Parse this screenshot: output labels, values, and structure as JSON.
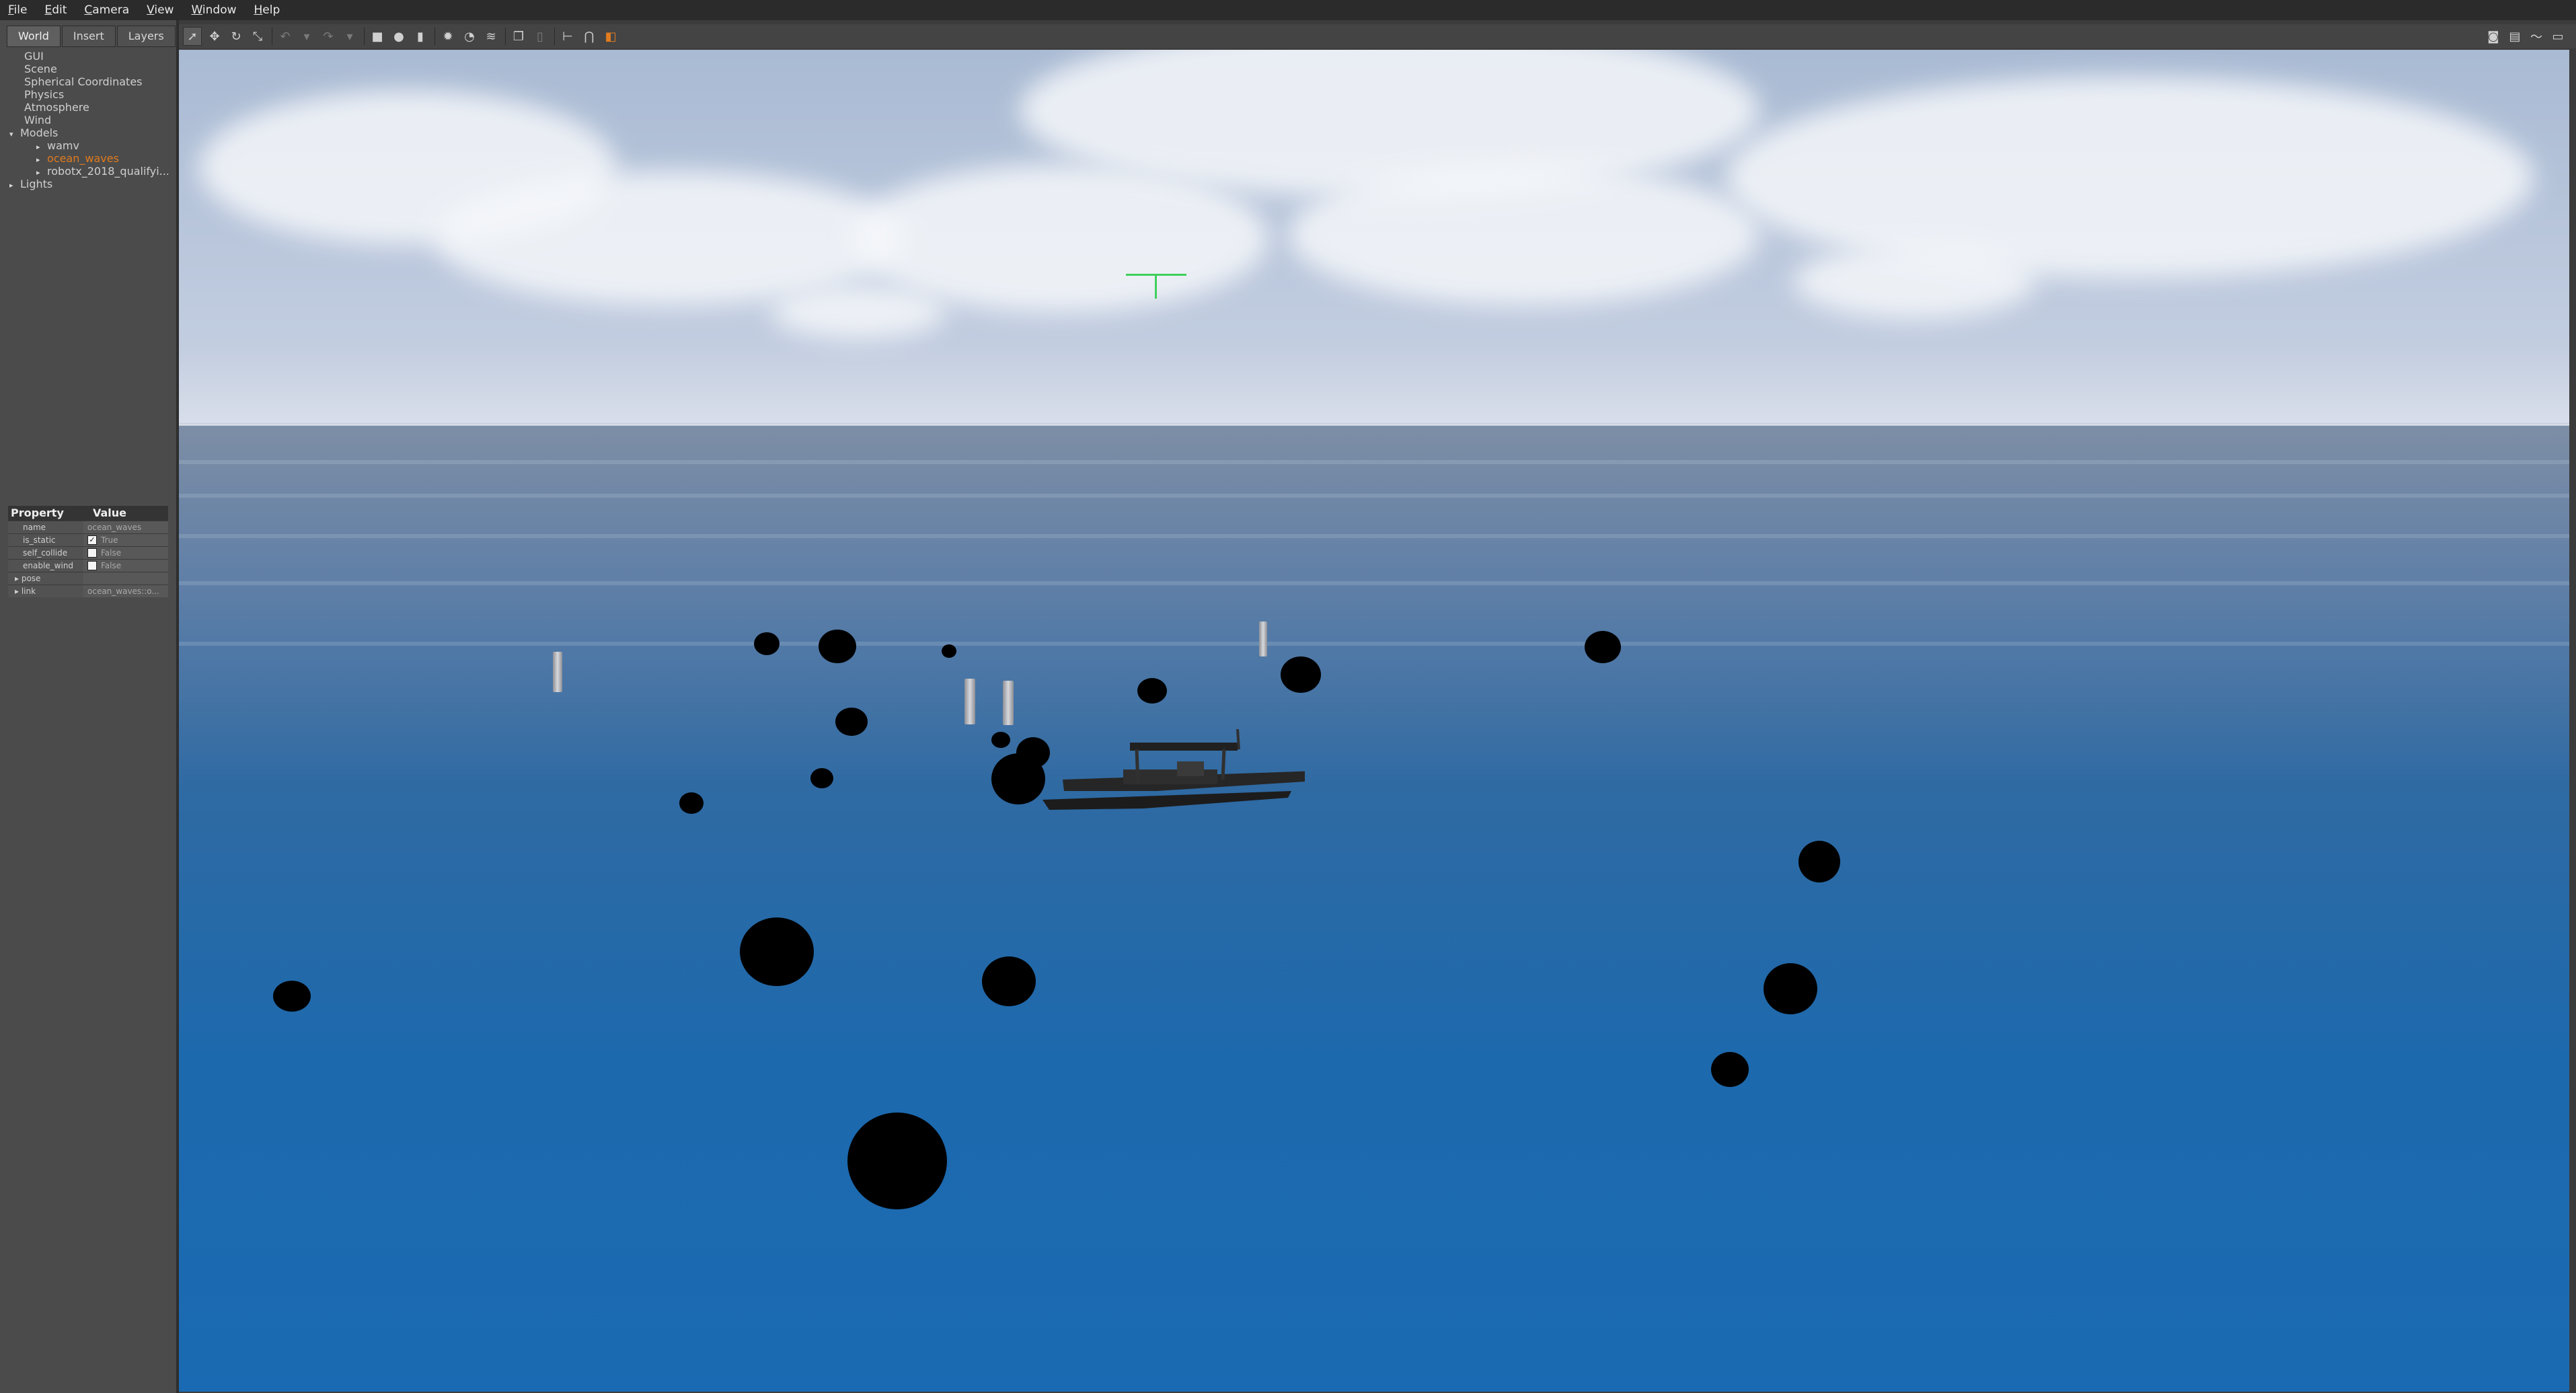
{
  "menu": {
    "items": [
      {
        "u": "F",
        "rest": "ile"
      },
      {
        "u": "E",
        "rest": "dit"
      },
      {
        "u": "C",
        "rest": "amera"
      },
      {
        "u": "V",
        "rest": "iew"
      },
      {
        "u": "W",
        "rest": "indow"
      },
      {
        "u": "H",
        "rest": "elp"
      }
    ]
  },
  "left_panel": {
    "tabs": [
      "World",
      "Insert",
      "Layers"
    ],
    "active_tab": "World",
    "tree": [
      {
        "label": "GUI",
        "level": 1
      },
      {
        "label": "Scene",
        "level": 1
      },
      {
        "label": "Spherical Coordinates",
        "level": 1
      },
      {
        "label": "Physics",
        "level": 1
      },
      {
        "label": "Atmosphere",
        "level": 1
      },
      {
        "label": "Wind",
        "level": 1
      },
      {
        "label": "Models",
        "level": 0,
        "arrow": "▾"
      },
      {
        "label": "wamv",
        "level": 2,
        "arrow": "▸"
      },
      {
        "label": "ocean_waves",
        "level": 2,
        "arrow": "▸",
        "selected": true
      },
      {
        "label": "robotx_2018_qualifyi...",
        "level": 2,
        "arrow": "▸"
      },
      {
        "label": "Lights",
        "level": 0,
        "arrow": "▸"
      }
    ],
    "properties": {
      "header_property": "Property",
      "header_value": "Value",
      "rows": [
        {
          "key": "name",
          "value": "ocean_waves",
          "checkbox": false
        },
        {
          "key": "is_static",
          "value": "True",
          "checkbox": true,
          "checked": true
        },
        {
          "key": "self_collide",
          "value": "False",
          "checkbox": true,
          "checked": false
        },
        {
          "key": "enable_wind",
          "value": "False",
          "checkbox": true,
          "checked": false
        },
        {
          "key": "pose",
          "value": "",
          "group": true
        },
        {
          "key": "link",
          "value": "ocean_waves::o...",
          "group": true
        }
      ]
    }
  },
  "toolbar": {
    "tools": [
      {
        "icon": "select-arrow-icon",
        "glyph": "➚",
        "active": true
      },
      {
        "icon": "translate-icon",
        "glyph": "✥"
      },
      {
        "icon": "rotate-icon",
        "glyph": "↻"
      },
      {
        "icon": "scale-icon",
        "glyph": "⤡"
      },
      {
        "icon": "undo-icon",
        "glyph": "↶",
        "dim": true
      },
      {
        "icon": "undo-history-icon",
        "glyph": "▾",
        "dim": true
      },
      {
        "icon": "redo-icon",
        "glyph": "↷",
        "dim": true
      },
      {
        "icon": "redo-history-icon",
        "glyph": "▾",
        "dim": true
      },
      {
        "icon": "box-icon",
        "glyph": "■"
      },
      {
        "icon": "sphere-icon",
        "glyph": "●"
      },
      {
        "icon": "cylinder-icon",
        "glyph": "▮"
      },
      {
        "icon": "point-light-icon",
        "glyph": "✹"
      },
      {
        "icon": "spot-light-icon",
        "glyph": "◔"
      },
      {
        "icon": "directional-light-icon",
        "glyph": "≋"
      },
      {
        "icon": "copy-icon",
        "glyph": "❐"
      },
      {
        "icon": "paste-icon",
        "glyph": "▯",
        "dim": true
      },
      {
        "icon": "align-icon",
        "glyph": "⊢"
      },
      {
        "icon": "snap-icon",
        "glyph": "⋂"
      },
      {
        "icon": "change-view-icon",
        "glyph": "◧",
        "color": "#e07b1f"
      }
    ],
    "right_tools": [
      {
        "icon": "screenshot-icon",
        "glyph": "◙"
      },
      {
        "icon": "log-icon",
        "glyph": "▤"
      },
      {
        "icon": "plot-icon",
        "glyph": "〜"
      },
      {
        "icon": "record-video-icon",
        "glyph": "▭"
      }
    ]
  },
  "viewport": {
    "scene": "ocean-with-boat-and-buoys",
    "colors": {
      "sky_top": "#a9bad3",
      "horizon": "#d8deea",
      "water_deep": "#1a6ab3",
      "selected": "#e07b1f",
      "origin_marker": "#3ecf5c"
    }
  }
}
